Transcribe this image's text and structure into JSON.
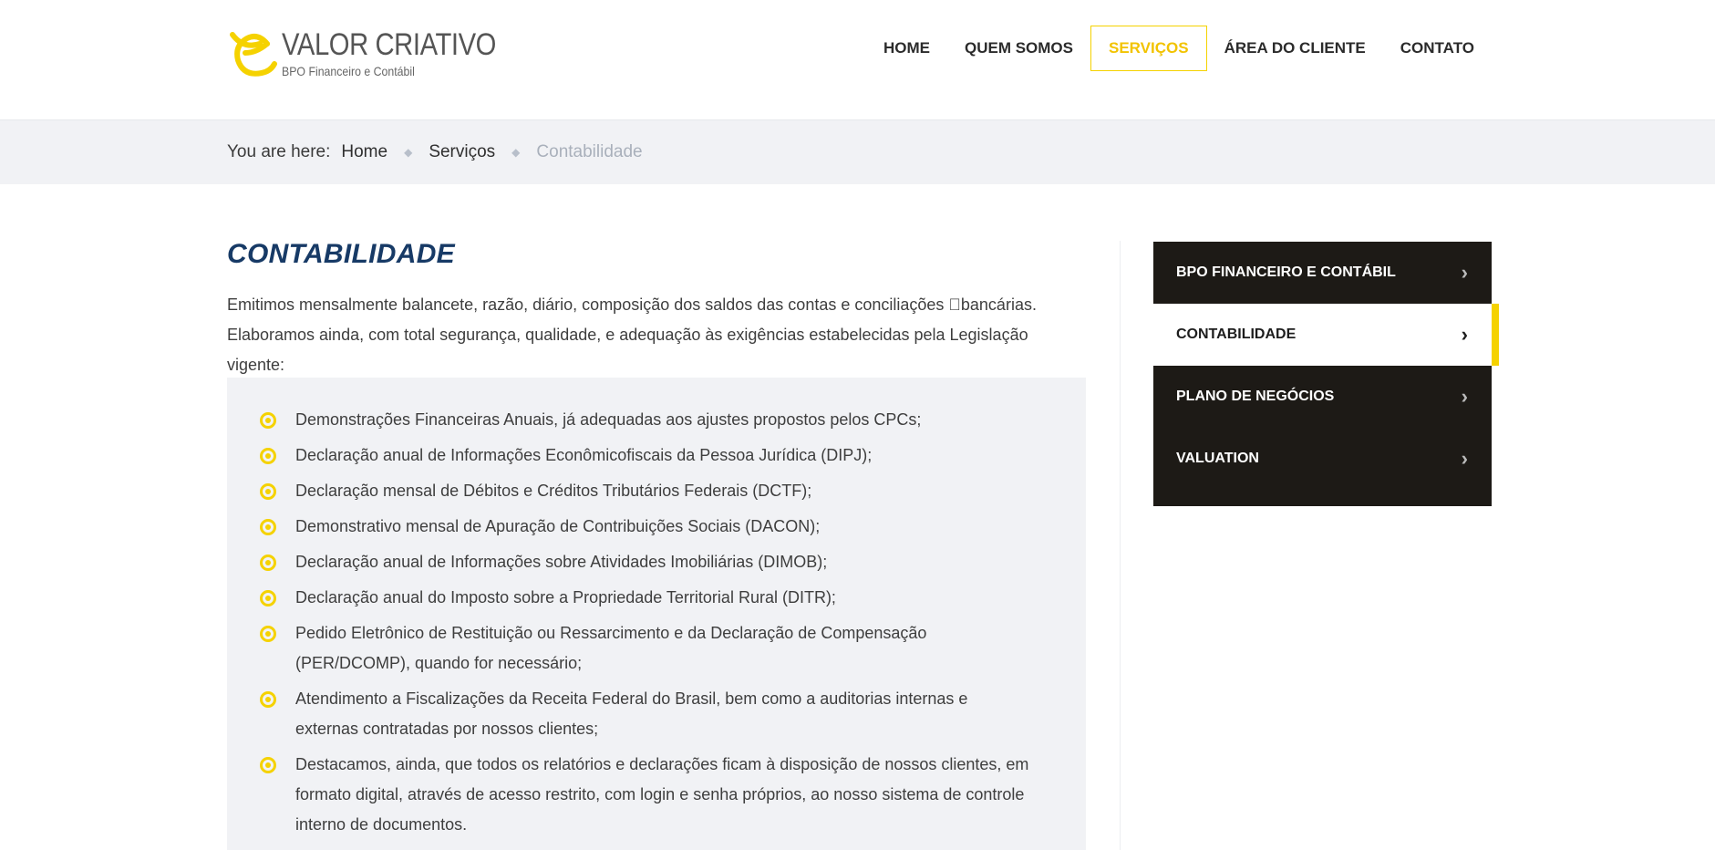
{
  "brand": {
    "name": "VALOR CRIATIVO",
    "tagline": "BPO Financeiro e Contábil",
    "accent_color": "#f5d200",
    "dark_color": "#1d1a16",
    "title_color": "#173a66"
  },
  "nav": {
    "items": [
      {
        "label": "HOME"
      },
      {
        "label": "QUEM SOMOS"
      },
      {
        "label": "SERVIÇOS",
        "active": true
      },
      {
        "label": "ÁREA DO CLIENTE"
      },
      {
        "label": "CONTATO"
      }
    ]
  },
  "breadcrumb": {
    "prefix": "You are here:",
    "items": [
      "Home",
      "Serviços"
    ],
    "current": "Contabilidade",
    "separator_icon": "diamond-icon"
  },
  "main": {
    "title": "CONTABILIDADE",
    "intro_line1": "Emitimos mensalmente balancete, razão, diário, composição dos saldos das contas e conciliações bancárias.",
    "intro_line2": "Elaboramos ainda, com total segurança, qualidade, e adequação às exigências estabelecidas pela Legislação vigente:",
    "list": [
      "Demonstrações Financeiras Anuais, já adequadas aos ajustes propostos pelos CPCs;",
      "Declaração anual de Informações Econômicofiscais da Pessoa Jurídica (DIPJ);",
      "Declaração mensal de Débitos e Créditos Tributários Federais (DCTF);",
      "Demonstrativo mensal de Apuração de Contribuições Sociais (DACON);",
      "Declaração anual de Informações sobre Atividades Imobiliárias (DIMOB);",
      "Declaração anual do Imposto sobre a Propriedade Territorial Rural (DITR);",
      "Pedido Eletrônico de Restituição ou Ressarcimento e da Declaração de Compensação (PER/DCOMP), quando for necessário;",
      "Atendimento a Fiscalizações da Receita Federal do Brasil, bem como a auditorias internas e externas contratadas por nossos clientes;",
      "Destacamos, ainda, que todos os relatórios e declarações ficam à disposição de nossos clientes, em formato digital, através de acesso restrito, com login e senha próprios, ao nosso sistema de controle interno de documentos."
    ],
    "bullet_icon": "circle-dot-icon"
  },
  "sidebar": {
    "items": [
      {
        "label": "BPO FINANCEIRO E CONTÁBIL"
      },
      {
        "label": "CONTABILIDADE",
        "active": true
      },
      {
        "label": "PLANO DE NEGÓCIOS"
      },
      {
        "label": "VALUATION"
      }
    ],
    "chevron": "›",
    "chevron_icon": "chevron-right-icon"
  }
}
